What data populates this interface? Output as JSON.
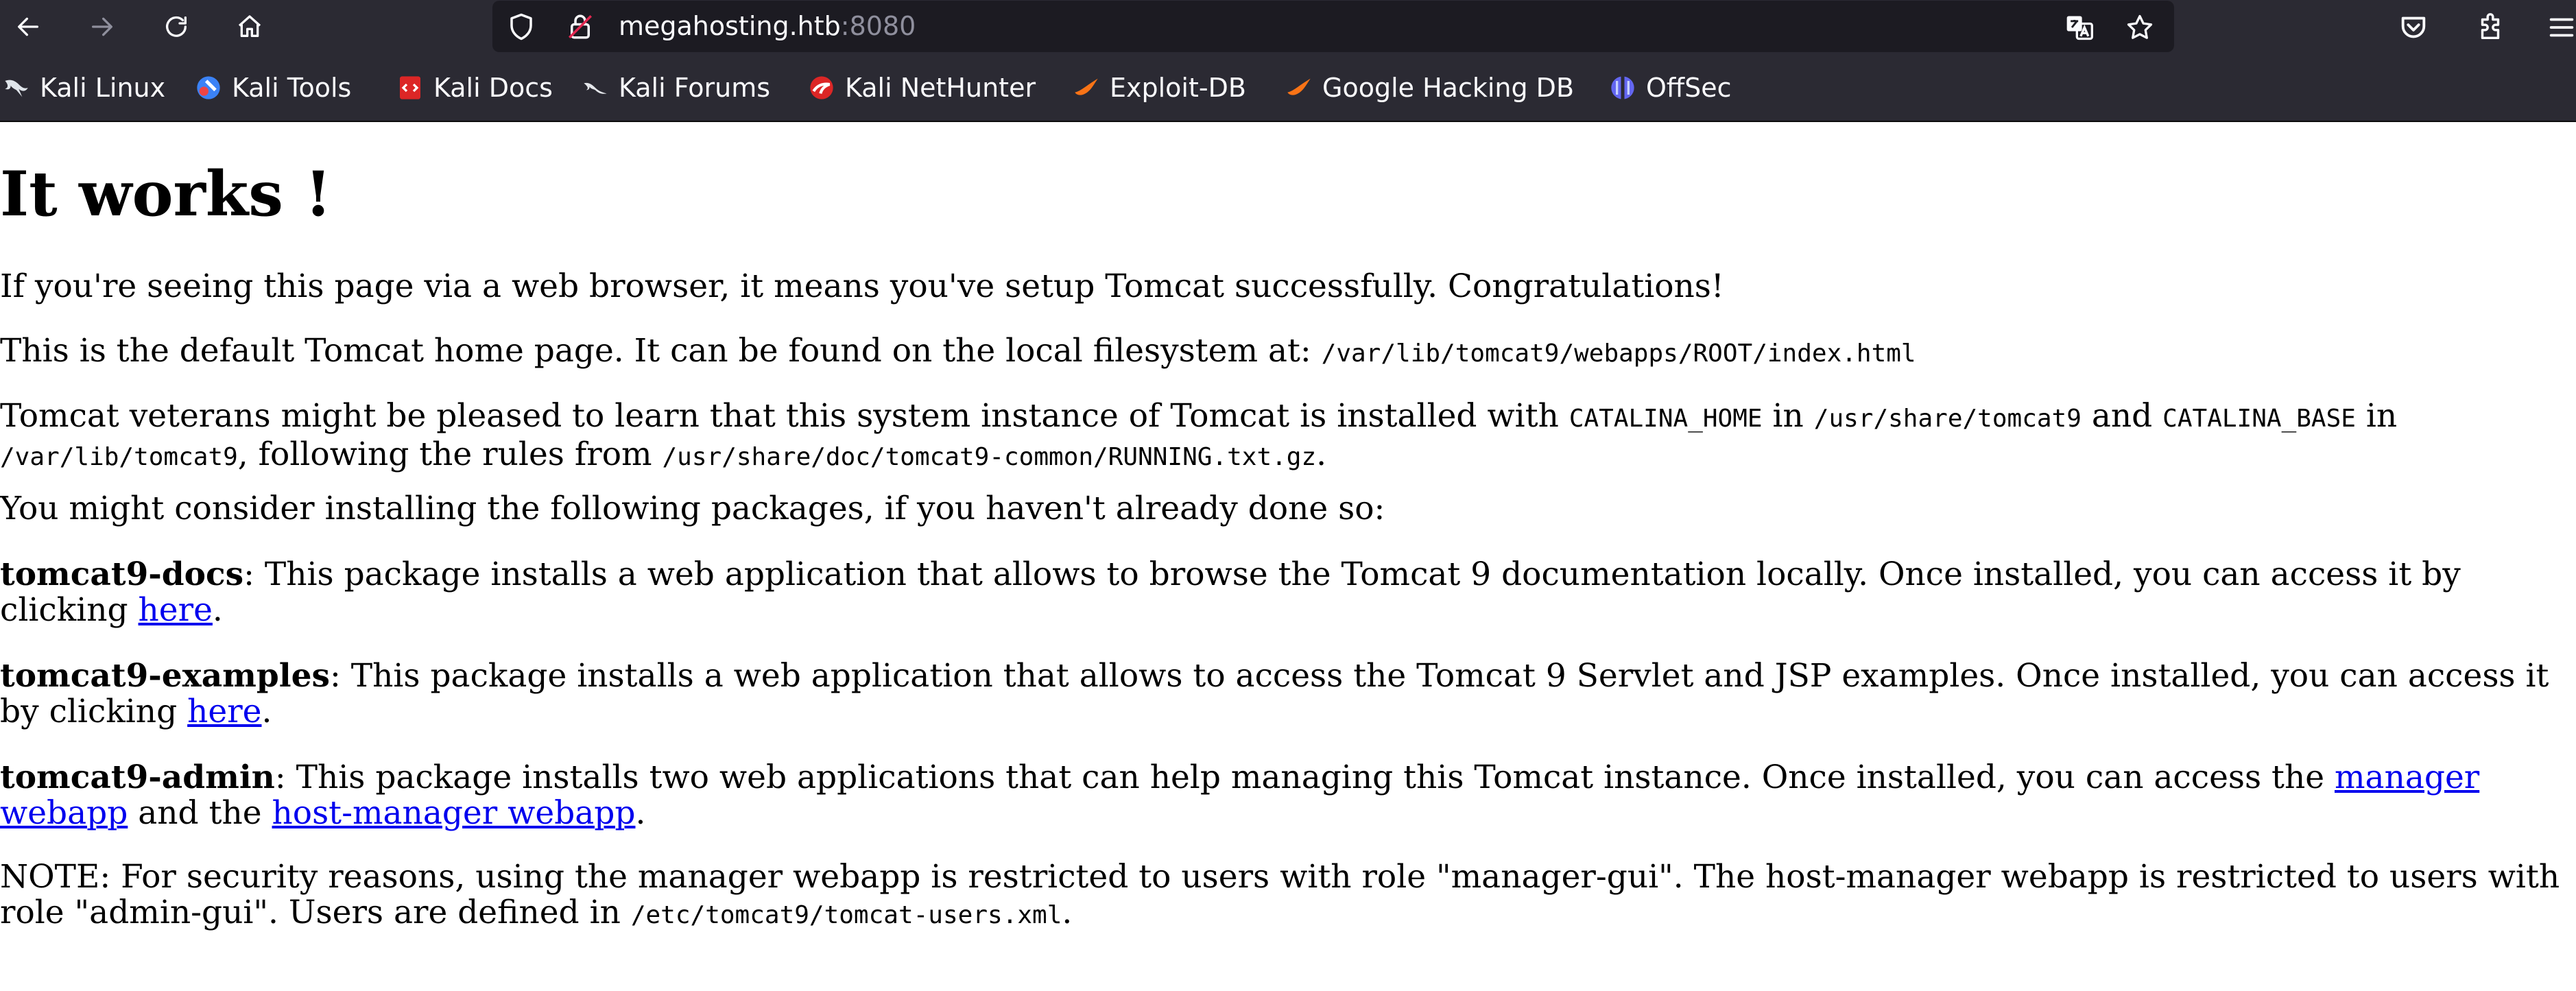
{
  "browser": {
    "url_host": "megahosting.htb",
    "url_port": ":8080",
    "bookmarks": [
      {
        "label": "Kali Linux",
        "icon": "kali-dragon-icon"
      },
      {
        "label": "Kali Tools",
        "icon": "kali-tools-icon"
      },
      {
        "label": "Kali Docs",
        "icon": "kali-docs-icon"
      },
      {
        "label": "Kali Forums",
        "icon": "kali-forums-icon"
      },
      {
        "label": "Kali NetHunter",
        "icon": "nethunter-icon"
      },
      {
        "label": "Exploit-DB",
        "icon": "exploit-db-icon"
      },
      {
        "label": "Google Hacking DB",
        "icon": "ghdb-icon"
      },
      {
        "label": "OffSec",
        "icon": "offsec-icon"
      }
    ]
  },
  "page": {
    "heading": "It works !",
    "p1": "If you're seeing this page via a web browser, it means you've setup Tomcat successfully. Congratulations!",
    "p2_text": "This is the default Tomcat home page. It can be found on the local filesystem at: ",
    "p2_code": "/var/lib/tomcat9/webapps/ROOT/index.html",
    "p3_a": "Tomcat veterans might be pleased to learn that this system instance of Tomcat is installed with ",
    "p3_code1": "CATALINA_HOME",
    "p3_b": " in ",
    "p3_code2": "/usr/share/tomcat9",
    "p3_c": " and ",
    "p3_code3": "CATALINA_BASE",
    "p3_d": " in ",
    "p3_code4": "/var/lib/tomcat9",
    "p3_e": ", following the rules from ",
    "p3_code5": "/usr/share/doc/tomcat9-common/RUNNING.txt.gz",
    "p3_f": ".",
    "p4": "You might consider installing the following packages, if you haven't already done so:",
    "docs_name": "tomcat9-docs",
    "docs_text": ": This package installs a web application that allows to browse the Tomcat 9 documentation locally. Once installed, you can access it by clicking ",
    "docs_link": "here",
    "examples_name": "tomcat9-examples",
    "examples_text": ": This package installs a web application that allows to access the Tomcat 9 Servlet and JSP examples. Once installed, you can access it by clicking ",
    "examples_link": "here",
    "admin_name": "tomcat9-admin",
    "admin_text": ": This package installs two web applications that can help managing this Tomcat instance. Once installed, you can access the ",
    "admin_link1": "manager webapp",
    "admin_mid": " and the ",
    "admin_link2": "host-manager webapp",
    "period": ".",
    "note_text": "NOTE: For security reasons, using the manager webapp is restricted to users with role \"manager-gui\". The host-manager webapp is restricted to users with role \"admin-gui\". Users are defined in ",
    "note_code": "/etc/tomcat9/tomcat-users.xml",
    "note_end": "."
  }
}
